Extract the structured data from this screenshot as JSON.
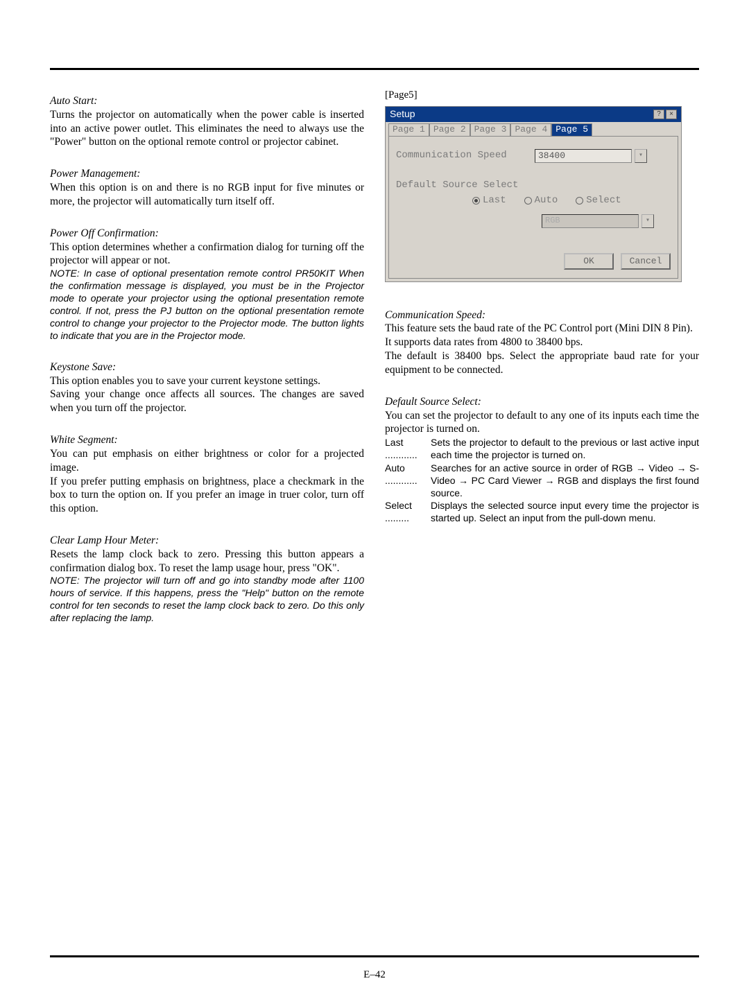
{
  "page_number": "E–42",
  "left": {
    "auto_start": {
      "title": "Auto Start:",
      "body": "Turns the projector on automatically when the power cable is inserted into an active power outlet. This eliminates the need to always use the \"Power\" button on the optional remote control or projector cabinet."
    },
    "power_mgmt": {
      "title": "Power Management:",
      "body": "When this option is on and there is no RGB input for five minutes or more, the projector will automatically turn itself off."
    },
    "power_off": {
      "title": "Power Off Confirmation:",
      "body": "This option determines whether a confirmation dialog for turning off the projector will appear or not.",
      "note": "NOTE: In case of optional presentation remote control PR50KIT\nWhen the confirmation message is displayed, you must be in the Projector mode to operate your projector using the optional presentation remote control. If not, press the PJ button on the optional presentation remote control to change your projector to the Projector mode. The button lights to indicate that you are in the Projector mode."
    },
    "keystone": {
      "title": "Keystone Save:",
      "body1": "This option enables you to save your current keystone settings.",
      "body2": "Saving your change once affects all sources. The changes are saved when you turn off the projector."
    },
    "white_seg": {
      "title": "White Segment:",
      "body1": "You can put emphasis on either brightness or color for a projected image.",
      "body2": "If you prefer putting emphasis on brightness, place a checkmark in the box to turn the option on. If you prefer an image in truer color, turn off this option."
    },
    "clear_lamp": {
      "title": "Clear Lamp Hour Meter:",
      "body": "Resets the lamp clock back to zero. Pressing this button appears a confirmation dialog box. To reset the lamp usage hour, press \"OK\".",
      "note": "NOTE: The projector will turn off and go into standby mode after 1100 hours of service. If this happens, press the \"Help\" button on the remote control for ten seconds to reset the lamp clock back to zero. Do this only after replacing the lamp."
    }
  },
  "right": {
    "page5_label": "[Page5]",
    "dialog": {
      "title": "Setup",
      "help": "?",
      "close": "×",
      "tabs": [
        "Page 1",
        "Page 2",
        "Page 3",
        "Page 4",
        "Page 5"
      ],
      "active_tab": 4,
      "comm_speed_label": "Communication Speed",
      "comm_speed_value": "38400",
      "default_source_label": "Default Source Select",
      "radios": {
        "last": "Last",
        "auto": "Auto",
        "select": "Select"
      },
      "disabled_value": "RGB",
      "ok": "OK",
      "cancel": "Cancel"
    },
    "comm_speed": {
      "title": "Communication Speed:",
      "body1": "This feature sets the baud rate of the PC Control port (Mini DIN 8 Pin).",
      "body2": "It supports data rates from 4800 to 38400 bps.",
      "body3": "The default is 38400 bps. Select the appropriate baud rate for your equipment to be connected."
    },
    "default_source": {
      "title": "Default Source Select:",
      "body": "You can set the projector to default to any one of its inputs each time the projector is turned on.",
      "defs": {
        "last_term": "Last ............",
        "last_desc": "Sets the projector to default to the previous or last active input each time the projector is turned on.",
        "auto_term": "Auto ............",
        "auto_desc": "Searches for an active source in order of RGB → Video → S-Video → PC Card Viewer → RGB and displays the first found source.",
        "select_term": "Select .........",
        "select_desc": "Displays the selected source input every time the projector is started up. Select an input from the pull-down menu."
      }
    }
  }
}
